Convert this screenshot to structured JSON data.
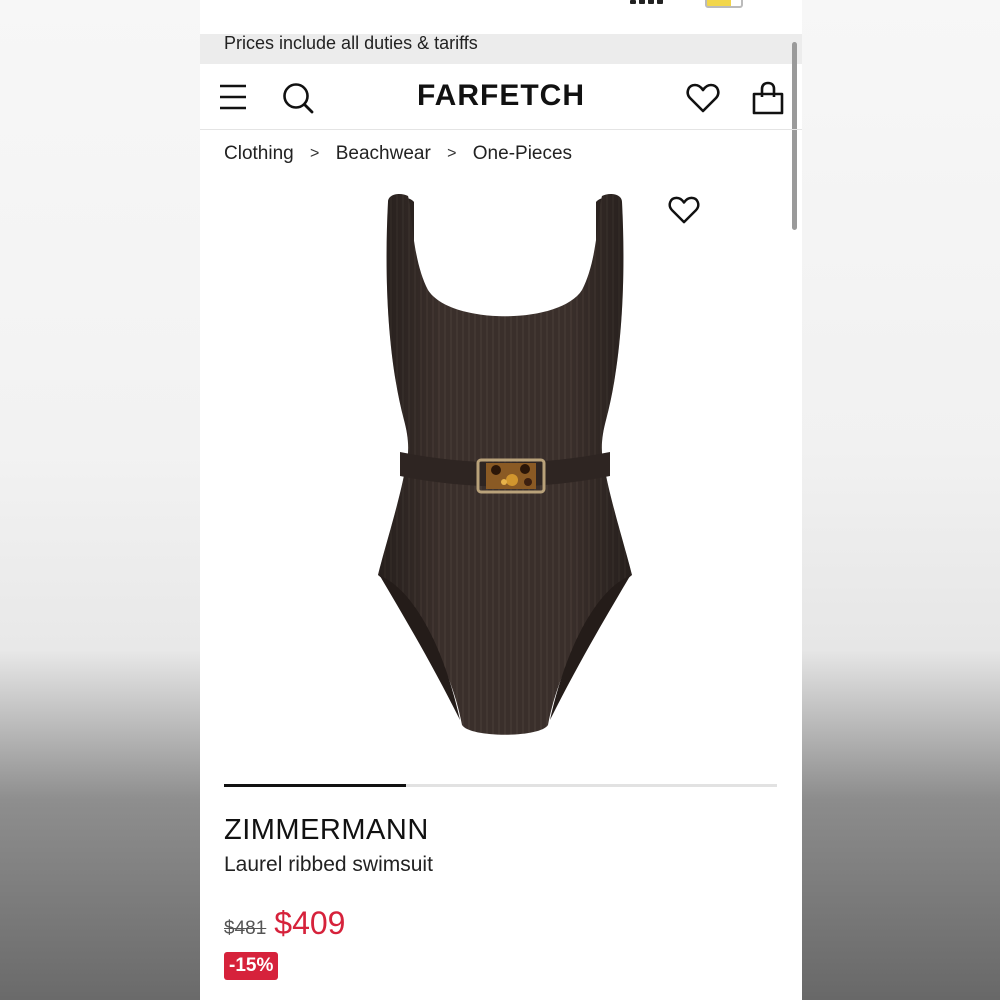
{
  "colors": {
    "sale_red": "#d6223b",
    "banner_bg": "#ececec",
    "swimsuit": "#3a2f2b"
  },
  "banner": {
    "text": "Prices include all duties & tariffs"
  },
  "header": {
    "logo": "FARFETCH",
    "menu_icon": "menu-icon",
    "search_icon": "search-icon",
    "wishlist_icon": "heart-icon",
    "bag_icon": "shopping-bag-icon"
  },
  "breadcrumb": {
    "items": [
      "Clothing",
      "Beachwear",
      "One-Pieces"
    ],
    "separator": ">"
  },
  "product": {
    "brand": "ZIMMERMANN",
    "name": "Laurel ribbed swimsuit",
    "original_price": "$481",
    "sale_price": "$409",
    "discount": "-15%",
    "image_progress": 0.33
  }
}
